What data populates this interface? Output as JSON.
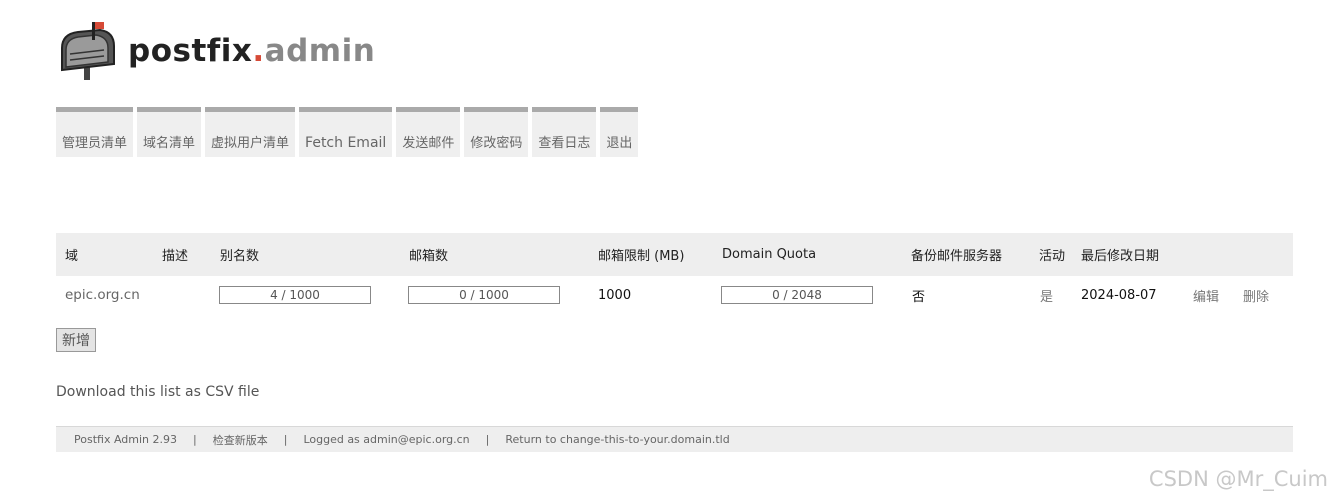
{
  "logo": {
    "part1": "postfix",
    "dot": ".",
    "part2": "admin",
    "icon": "mailbox-icon"
  },
  "menu": [
    "管理员清单",
    "域名清单",
    "虚拟用户清单",
    "Fetch Email",
    "发送邮件",
    "修改密码",
    "查看日志",
    "退出"
  ],
  "table": {
    "headers": [
      "域",
      "描述",
      "别名数",
      "邮箱数",
      "邮箱限制 (MB)",
      "Domain Quota",
      "备份邮件服务器",
      "活动",
      "最后修改日期"
    ],
    "rows": [
      {
        "domain": "epic.org.cn",
        "description": "",
        "aliases": "4 / 1000",
        "mailboxes": "0 / 1000",
        "mailbox_limit": "1000",
        "domain_quota": "0 / 2048",
        "backup_mx": "否",
        "active": "是",
        "last_modified": "2024-08-07",
        "edit": "编辑",
        "delete": "删除"
      }
    ]
  },
  "add_button": "新增",
  "csv_link": "Download this list as CSV file",
  "footer": {
    "version": "Postfix Admin 2.93",
    "check_update": "检查新版本",
    "logged_as": "Logged as admin@epic.org.cn",
    "return_link": "Return to change-this-to-your.domain.tld",
    "separator": "|"
  },
  "watermark": "CSDN @Mr_Cuim",
  "colors": {
    "accent": "#d64a37",
    "menu_bg": "#efefef",
    "menu_border": "#aaaaaa",
    "header_bg": "#eeeeee"
  }
}
